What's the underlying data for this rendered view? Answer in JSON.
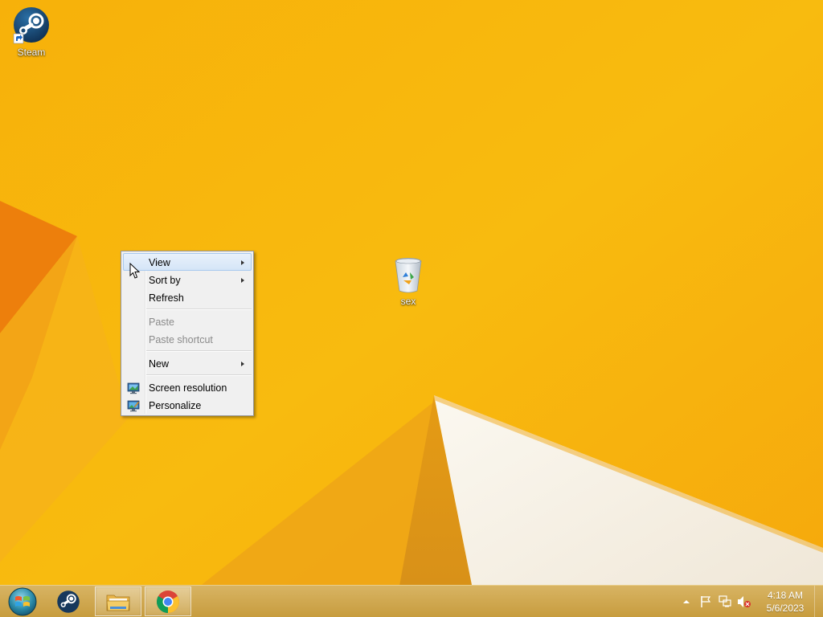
{
  "desktop": {
    "icons": [
      {
        "label": "Steam",
        "icon": "steam-icon"
      },
      {
        "label": "sex",
        "icon": "recycle-bin-icon"
      }
    ]
  },
  "context_menu": {
    "items": [
      {
        "label": "View",
        "submenu": true,
        "state": "hover"
      },
      {
        "label": "Sort by",
        "submenu": true
      },
      {
        "label": "Refresh"
      },
      {
        "label": "Paste",
        "disabled": true
      },
      {
        "label": "Paste shortcut",
        "disabled": true
      },
      {
        "label": "New",
        "submenu": true
      },
      {
        "label": "Screen resolution",
        "icon": "monitor-icon"
      },
      {
        "label": "Personalize",
        "icon": "personalize-icon"
      }
    ]
  },
  "taskbar": {
    "buttons": [
      {
        "name": "Start",
        "icon": "start-orb-icon"
      },
      {
        "name": "Steam",
        "icon": "steam-icon"
      },
      {
        "name": "File Explorer",
        "icon": "folder-icon"
      },
      {
        "name": "Google Chrome",
        "icon": "chrome-icon",
        "active": true
      }
    ],
    "tray": {
      "icons": [
        "show-hidden-icons-arrow",
        "action-center-flag-icon",
        "network-icon",
        "speaker-muted-icon"
      ],
      "time": "4:18 AM",
      "date": "5/6/2023"
    }
  },
  "colors": {
    "wallpaper": "#f7b80d",
    "taskbar": "#cfa64f",
    "menu_bg": "#f0f0f0",
    "hover": "#d5e5f7"
  }
}
